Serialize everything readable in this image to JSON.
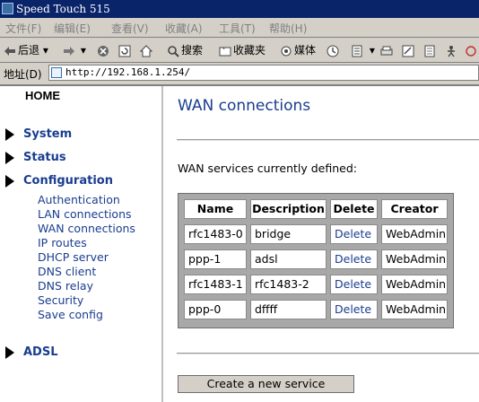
{
  "window": {
    "title": "Speed Touch 515"
  },
  "menu": [
    "文件(F)",
    "编辑(E)",
    "查看(V)",
    "收藏(A)",
    "工具(T)",
    "帮助(H)"
  ],
  "toolbar": {
    "back": "后退",
    "search": "搜索",
    "favorites": "收藏夹",
    "media": "媒体"
  },
  "address": {
    "label": "地址(D)",
    "url": "http://192.168.1.254/"
  },
  "sidebar": {
    "home": "HOME",
    "groups": [
      {
        "label": "System"
      },
      {
        "label": "Status"
      },
      {
        "label": "Configuration"
      },
      {
        "label": "ADSL"
      }
    ],
    "config_items": [
      "Authentication",
      "LAN connections",
      "WAN connections",
      "IP routes",
      "DHCP server",
      "DNS client",
      "DNS relay",
      "Security",
      "Save config"
    ]
  },
  "main": {
    "title": "WAN connections",
    "description": "WAN services currently defined:",
    "table": {
      "headers": [
        "Name",
        "Description",
        "Delete",
        "Creator"
      ],
      "rows": [
        [
          "rfc1483-0",
          "bridge",
          "Delete",
          "WebAdmin"
        ],
        [
          "ppp-1",
          "adsl",
          "Delete",
          "WebAdmin"
        ],
        [
          "rfc1483-1",
          "rfc1483-2",
          "Delete",
          "WebAdmin"
        ],
        [
          "ppp-0",
          "dffff",
          "Delete",
          "WebAdmin"
        ]
      ]
    },
    "create_button": "Create a new service"
  },
  "colors": {
    "link": "#1a3d8f",
    "titlebar": "#0a246a",
    "chrome": "#d4d0c8"
  }
}
